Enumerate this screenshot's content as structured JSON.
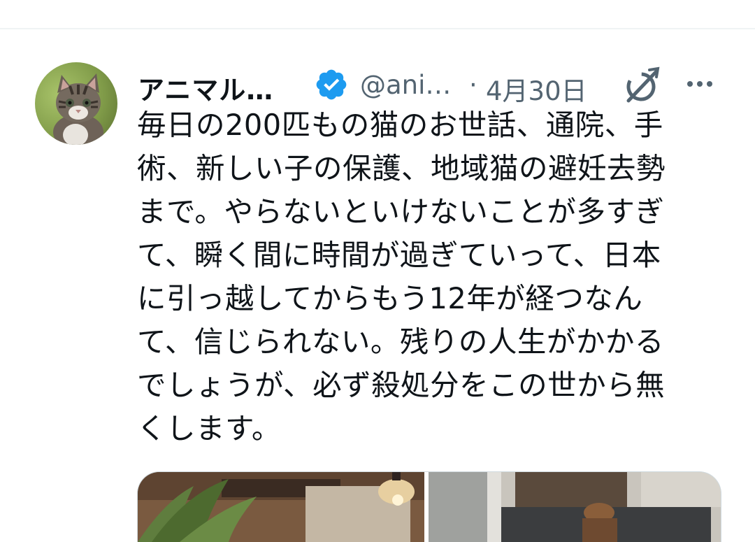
{
  "tweet": {
    "author": {
      "display_name": "アニマル…",
      "handle": "@ani…",
      "verified": true,
      "avatar_icon": "kitten-avatar"
    },
    "separator": "·",
    "date": "4月30日",
    "grok_icon": "grok-icon",
    "more_icon": "more-options-icon",
    "text": "毎日の200匹もの猫のお世話、通院、手\n術、新しい子の保護、地域猫の避妊去勢\nまで。やらないといけないことが多すぎ\nて、瞬く間に時間が過ぎていって、日本\nに引っ越してからもう12年が経つなん\nて、信じられない。残りの人生がかかる\nでしょうが、必ず殺処分をこの世から無\nくします。",
    "media": {
      "images": [
        "restaurant-photo",
        "street-photo"
      ]
    }
  },
  "colors": {
    "text_primary": "#0f1419",
    "text_secondary": "#536471",
    "verified_blue": "#1d9bf0",
    "divider": "#eff3f4"
  }
}
